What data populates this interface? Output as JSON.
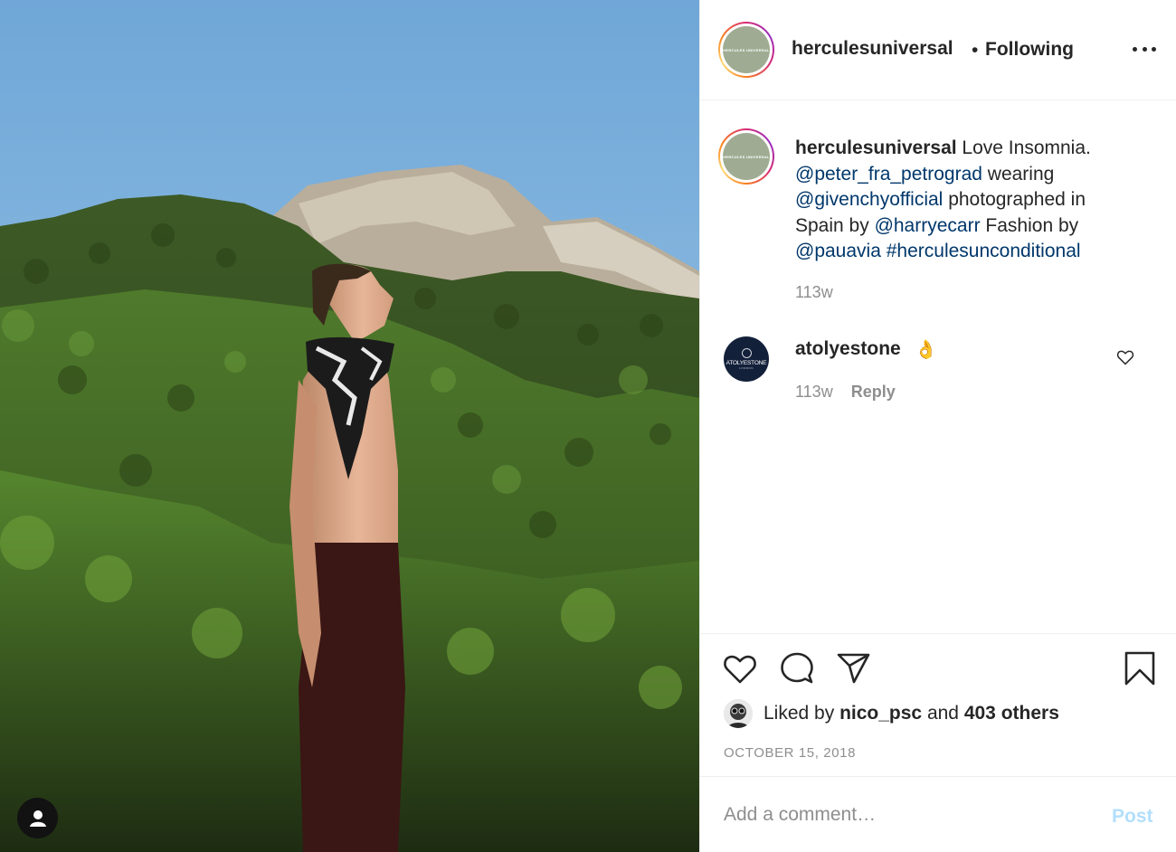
{
  "post": {
    "author": "herculesuniversal",
    "avatar_text": "HERCULES UNIVERSAL",
    "header_separator": "•",
    "follow_status": "Following",
    "more_icon": "more-horizontal-icon"
  },
  "caption": {
    "username": "herculesuniversal",
    "parts": [
      {
        "text": " Love Insomnia. ",
        "link": false
      },
      {
        "text": "@peter_fra_petrograd",
        "link": true
      },
      {
        "text": " wearing ",
        "link": false
      },
      {
        "text": "@givenchyofficial",
        "link": true
      },
      {
        "text": " photographed in Spain by ",
        "link": false
      },
      {
        "text": "@harryecarr",
        "link": true
      },
      {
        "text": " Fashion by ",
        "link": false
      },
      {
        "text": "@pauavia",
        "link": true
      },
      {
        "text": " ",
        "link": false
      },
      {
        "text": "#herculesunconditional",
        "link": true
      }
    ],
    "time": "113w"
  },
  "comments": [
    {
      "username": "atolyestone",
      "avatar_text": "ATOLYESTONE",
      "avatar_subtext": "LONDON",
      "text": "👌",
      "time": "113w",
      "reply_label": "Reply"
    }
  ],
  "actions": {
    "like_icon": "heart-icon",
    "comment_icon": "comment-icon",
    "share_icon": "paper-plane-icon",
    "save_icon": "bookmark-icon"
  },
  "likes": {
    "prefix": "Liked by ",
    "user": "nico_psc",
    "middle": " and ",
    "others": "403 others"
  },
  "date": "OCTOBER 15, 2018",
  "comment_box": {
    "placeholder": "Add a comment…",
    "post_label": "Post"
  },
  "colors": {
    "link": "#00376b",
    "muted": "#8e8e8e",
    "post_disabled": "#b2dffc",
    "avatar_bg": "#9fac93"
  }
}
